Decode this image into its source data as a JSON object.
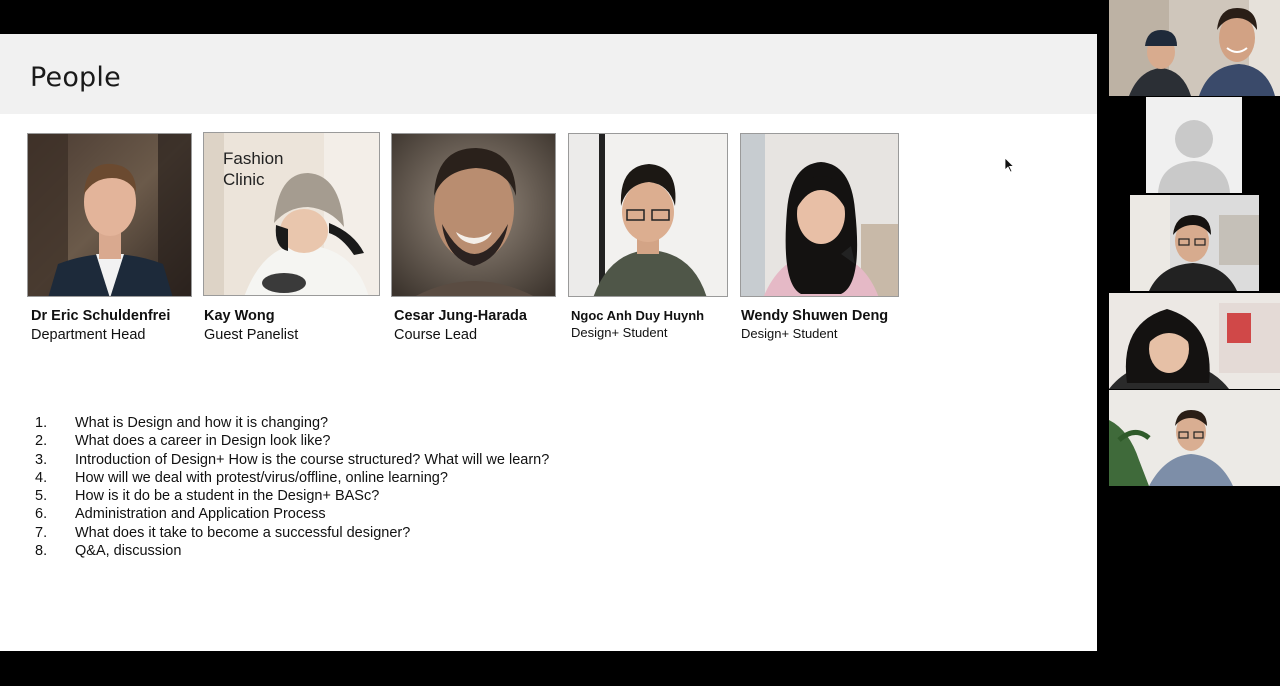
{
  "slide": {
    "title": "People",
    "people": [
      {
        "name": "Dr Eric Schuldenfrei",
        "role": "Department Head"
      },
      {
        "name": "Kay Wong",
        "role": "Guest Panelist",
        "photo_text_1": "Fashion",
        "photo_text_2": "Clinic"
      },
      {
        "name": "Cesar Jung-Harada",
        "role": "Course Lead"
      },
      {
        "name": "Ngoc Anh Duy Huynh",
        "role": "Design+ Student"
      },
      {
        "name": "Wendy Shuwen Deng",
        "role": "Design+ Student"
      }
    ],
    "agenda": [
      {
        "num": "1.",
        "text": "What is Design and how it is changing?"
      },
      {
        "num": "2.",
        "text": "What does a career in Design look like?"
      },
      {
        "num": "3.",
        "text": "Introduction of Design+ How is the course structured? What will we learn?"
      },
      {
        "num": "4.",
        "text": "How will we deal with protest/virus/offline, online learning?"
      },
      {
        "num": "5.",
        "text": "How is it do be a student in the Design+ BASc?"
      },
      {
        "num": "6.",
        "text": "Administration and Application Process"
      },
      {
        "num": "7.",
        "text": "What does it take to become a successful designer?"
      },
      {
        "num": "8.",
        "text": "Q&A, discussion"
      }
    ]
  },
  "participants": [
    {
      "id": "participant-1",
      "kind": "video"
    },
    {
      "id": "participant-2",
      "kind": "avatar-placeholder"
    },
    {
      "id": "participant-3",
      "kind": "video"
    },
    {
      "id": "participant-4",
      "kind": "video"
    },
    {
      "id": "participant-5",
      "kind": "video"
    }
  ],
  "colors": {
    "background": "#000000",
    "slide": "#ffffff",
    "header_band": "#f1f1f1",
    "text": "#111111"
  }
}
